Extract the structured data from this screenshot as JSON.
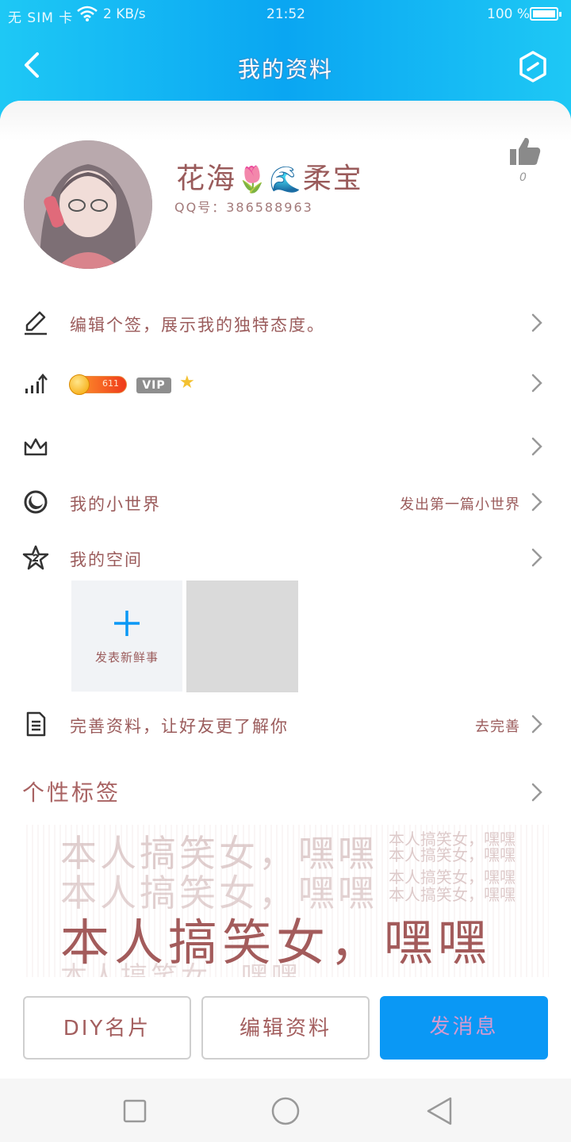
{
  "status_bar": {
    "carrier": "无 SIM 卡",
    "speed": "2 KB/s",
    "time": "21:52",
    "battery": "100 %"
  },
  "nav": {
    "title": "我的资料"
  },
  "profile": {
    "nickname": "花海",
    "nickname_emoji": "🌷🌊",
    "nickname_suffix": "柔宝",
    "qq_label": "QQ号：",
    "qq_number": "386588963",
    "like_count": "0"
  },
  "rows": {
    "signature": {
      "label": "编辑个签，展示我的独特态度。"
    },
    "level": {
      "coin_value": "611",
      "vip_label": "VIP"
    },
    "world": {
      "label": "我的小世界",
      "right": "发出第一篇小世界"
    },
    "space": {
      "label": "我的空间",
      "new_post": "发表新鲜事"
    },
    "complete": {
      "label": "完善资料，让好友更了解你",
      "right": "去完善"
    }
  },
  "tags": {
    "title": "个性标签",
    "banner_main": "本人搞笑女，嘿嘿",
    "banner_small": "本人搞笑女，嘿嘿"
  },
  "buttons": {
    "diy": "DIY名片",
    "edit": "编辑资料",
    "message": "发消息"
  },
  "colors": {
    "header": "#0aa6f2",
    "primary": "#0a98f5",
    "text": "#9b5c5c"
  }
}
